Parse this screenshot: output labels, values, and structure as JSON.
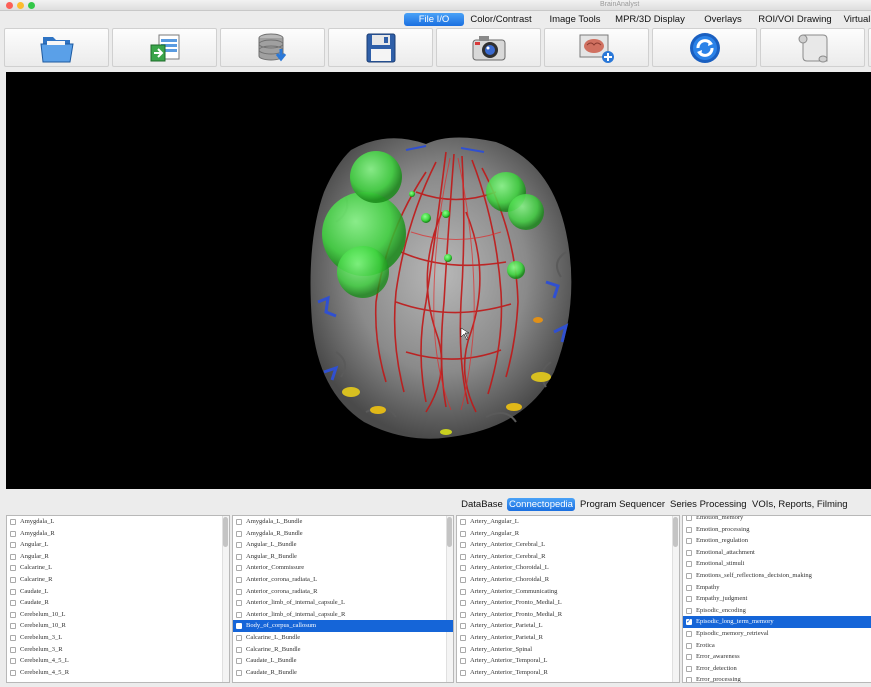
{
  "window": {
    "title": "BrainAnalyst"
  },
  "top_tabs": [
    {
      "label": "File I/O",
      "active": true
    },
    {
      "label": "Color/Contrast",
      "active": false
    },
    {
      "label": "Image Tools",
      "active": false
    },
    {
      "label": "MPR/3D Display",
      "active": false
    },
    {
      "label": "Overlays",
      "active": false
    },
    {
      "label": "ROI/VOI Drawing",
      "active": false
    },
    {
      "label": "Virtual",
      "active": false
    }
  ],
  "toolbar": {
    "buttons": [
      {
        "icon": "open-folder-icon"
      },
      {
        "icon": "import-data-icon"
      },
      {
        "icon": "database-download-icon"
      },
      {
        "icon": "save-disk-icon"
      },
      {
        "icon": "camera-snapshot-icon"
      },
      {
        "icon": "brain-add-icon"
      },
      {
        "icon": "refresh-cycle-icon"
      },
      {
        "icon": "script-scroll-icon"
      }
    ]
  },
  "bottom_tabs": [
    {
      "label": "DataBase",
      "active": false
    },
    {
      "label": "Connectopedia",
      "active": true
    },
    {
      "label": "Program Sequencer",
      "active": false
    },
    {
      "label": "Series Processing",
      "active": false
    },
    {
      "label": "VOIs, Reports, Filming",
      "active": false
    }
  ],
  "lists": {
    "regions": [
      "Amygdala_L",
      "Amygdala_R",
      "Angular_L",
      "Angular_R",
      "Calcarine_L",
      "Calcarine_R",
      "Caudate_L",
      "Caudate_R",
      "Cerebelum_10_L",
      "Cerebelum_10_R",
      "Cerebelum_3_L",
      "Cerebelum_3_R",
      "Cerebelum_4_5_L",
      "Cerebelum_4_5_R"
    ],
    "bundles": [
      "Amygdala_L_Bundle",
      "Amygdala_R_Bundle",
      "Angular_L_Bundle",
      "Angular_R_Bundle",
      "Anterior_Commissure",
      "Anterior_corona_radiata_L",
      "Anterior_corona_radiata_R",
      "Anterior_limb_of_internal_capsule_L",
      "Anterior_limb_of_internal_capsule_R",
      "Body_of_corpus_callosum",
      "Calcarine_L_Bundle",
      "Calcarine_R_Bundle",
      "Caudate_L_Bundle",
      "Caudate_R_Bundle"
    ],
    "bundles_selected": "Body_of_corpus_callosum",
    "arteries": [
      "Artery_Angular_L",
      "Artery_Angular_R",
      "Artery_Anterior_Cerebral_L",
      "Artery_Anterior_Cerebral_R",
      "Artery_Anterior_Choroidal_L",
      "Artery_Anterior_Choroidal_R",
      "Artery_Anterior_Communicating",
      "Artery_Anterior_Fronto_Medial_L",
      "Artery_Anterior_Fronto_Medial_R",
      "Artery_Anterior_Parietal_L",
      "Artery_Anterior_Parietal_R",
      "Artery_Anterior_Spinal",
      "Artery_Anterior_Temporal_L",
      "Artery_Anterior_Temporal_R"
    ],
    "functions": [
      "Emotion_memory",
      "Emotion_processing",
      "Emotion_regulation",
      "Emotional_attachment",
      "Emotional_stimuli",
      "Emotions_self_reflections_decision_making",
      "Empathy",
      "Empathy_judgment",
      "Episodic_encoding",
      "Episodic_long_term_memory",
      "Episodic_memory_retrieval",
      "Erotica",
      "Error_awareness",
      "Error_detection",
      "Error_processing"
    ],
    "functions_selected": "Episodic_long_term_memory"
  },
  "colors": {
    "accent": "#1a6fe0",
    "fiber": "#c01818",
    "sphere": "#3ed63e"
  }
}
